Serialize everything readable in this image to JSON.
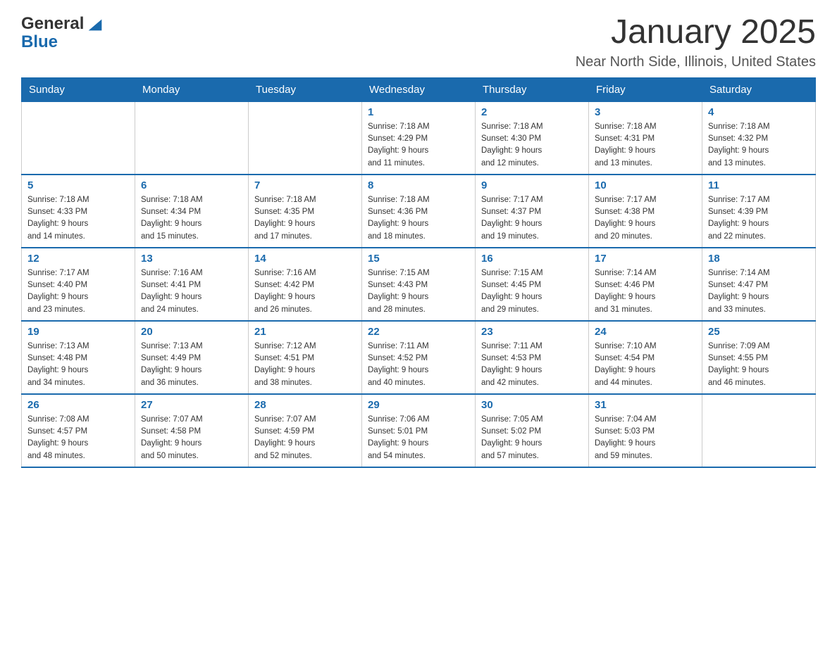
{
  "header": {
    "logo_general": "General",
    "logo_blue": "Blue",
    "title": "January 2025",
    "subtitle": "Near North Side, Illinois, United States"
  },
  "weekdays": [
    "Sunday",
    "Monday",
    "Tuesday",
    "Wednesday",
    "Thursday",
    "Friday",
    "Saturday"
  ],
  "weeks": [
    [
      {
        "day": "",
        "info": ""
      },
      {
        "day": "",
        "info": ""
      },
      {
        "day": "",
        "info": ""
      },
      {
        "day": "1",
        "info": "Sunrise: 7:18 AM\nSunset: 4:29 PM\nDaylight: 9 hours\nand 11 minutes."
      },
      {
        "day": "2",
        "info": "Sunrise: 7:18 AM\nSunset: 4:30 PM\nDaylight: 9 hours\nand 12 minutes."
      },
      {
        "day": "3",
        "info": "Sunrise: 7:18 AM\nSunset: 4:31 PM\nDaylight: 9 hours\nand 13 minutes."
      },
      {
        "day": "4",
        "info": "Sunrise: 7:18 AM\nSunset: 4:32 PM\nDaylight: 9 hours\nand 13 minutes."
      }
    ],
    [
      {
        "day": "5",
        "info": "Sunrise: 7:18 AM\nSunset: 4:33 PM\nDaylight: 9 hours\nand 14 minutes."
      },
      {
        "day": "6",
        "info": "Sunrise: 7:18 AM\nSunset: 4:34 PM\nDaylight: 9 hours\nand 15 minutes."
      },
      {
        "day": "7",
        "info": "Sunrise: 7:18 AM\nSunset: 4:35 PM\nDaylight: 9 hours\nand 17 minutes."
      },
      {
        "day": "8",
        "info": "Sunrise: 7:18 AM\nSunset: 4:36 PM\nDaylight: 9 hours\nand 18 minutes."
      },
      {
        "day": "9",
        "info": "Sunrise: 7:17 AM\nSunset: 4:37 PM\nDaylight: 9 hours\nand 19 minutes."
      },
      {
        "day": "10",
        "info": "Sunrise: 7:17 AM\nSunset: 4:38 PM\nDaylight: 9 hours\nand 20 minutes."
      },
      {
        "day": "11",
        "info": "Sunrise: 7:17 AM\nSunset: 4:39 PM\nDaylight: 9 hours\nand 22 minutes."
      }
    ],
    [
      {
        "day": "12",
        "info": "Sunrise: 7:17 AM\nSunset: 4:40 PM\nDaylight: 9 hours\nand 23 minutes."
      },
      {
        "day": "13",
        "info": "Sunrise: 7:16 AM\nSunset: 4:41 PM\nDaylight: 9 hours\nand 24 minutes."
      },
      {
        "day": "14",
        "info": "Sunrise: 7:16 AM\nSunset: 4:42 PM\nDaylight: 9 hours\nand 26 minutes."
      },
      {
        "day": "15",
        "info": "Sunrise: 7:15 AM\nSunset: 4:43 PM\nDaylight: 9 hours\nand 28 minutes."
      },
      {
        "day": "16",
        "info": "Sunrise: 7:15 AM\nSunset: 4:45 PM\nDaylight: 9 hours\nand 29 minutes."
      },
      {
        "day": "17",
        "info": "Sunrise: 7:14 AM\nSunset: 4:46 PM\nDaylight: 9 hours\nand 31 minutes."
      },
      {
        "day": "18",
        "info": "Sunrise: 7:14 AM\nSunset: 4:47 PM\nDaylight: 9 hours\nand 33 minutes."
      }
    ],
    [
      {
        "day": "19",
        "info": "Sunrise: 7:13 AM\nSunset: 4:48 PM\nDaylight: 9 hours\nand 34 minutes."
      },
      {
        "day": "20",
        "info": "Sunrise: 7:13 AM\nSunset: 4:49 PM\nDaylight: 9 hours\nand 36 minutes."
      },
      {
        "day": "21",
        "info": "Sunrise: 7:12 AM\nSunset: 4:51 PM\nDaylight: 9 hours\nand 38 minutes."
      },
      {
        "day": "22",
        "info": "Sunrise: 7:11 AM\nSunset: 4:52 PM\nDaylight: 9 hours\nand 40 minutes."
      },
      {
        "day": "23",
        "info": "Sunrise: 7:11 AM\nSunset: 4:53 PM\nDaylight: 9 hours\nand 42 minutes."
      },
      {
        "day": "24",
        "info": "Sunrise: 7:10 AM\nSunset: 4:54 PM\nDaylight: 9 hours\nand 44 minutes."
      },
      {
        "day": "25",
        "info": "Sunrise: 7:09 AM\nSunset: 4:55 PM\nDaylight: 9 hours\nand 46 minutes."
      }
    ],
    [
      {
        "day": "26",
        "info": "Sunrise: 7:08 AM\nSunset: 4:57 PM\nDaylight: 9 hours\nand 48 minutes."
      },
      {
        "day": "27",
        "info": "Sunrise: 7:07 AM\nSunset: 4:58 PM\nDaylight: 9 hours\nand 50 minutes."
      },
      {
        "day": "28",
        "info": "Sunrise: 7:07 AM\nSunset: 4:59 PM\nDaylight: 9 hours\nand 52 minutes."
      },
      {
        "day": "29",
        "info": "Sunrise: 7:06 AM\nSunset: 5:01 PM\nDaylight: 9 hours\nand 54 minutes."
      },
      {
        "day": "30",
        "info": "Sunrise: 7:05 AM\nSunset: 5:02 PM\nDaylight: 9 hours\nand 57 minutes."
      },
      {
        "day": "31",
        "info": "Sunrise: 7:04 AM\nSunset: 5:03 PM\nDaylight: 9 hours\nand 59 minutes."
      },
      {
        "day": "",
        "info": ""
      }
    ]
  ]
}
